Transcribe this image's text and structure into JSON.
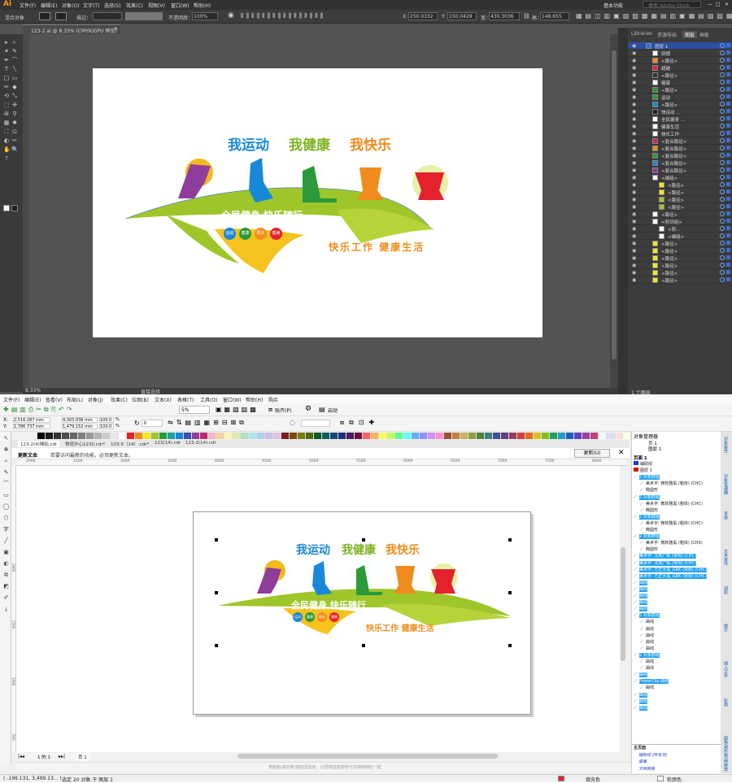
{
  "illustrator": {
    "logo": "Ai",
    "menu": [
      "文件(F)",
      "编辑(E)",
      "对象(O)",
      "文字(T)",
      "选择(S)",
      "效果(C)",
      "视图(V)",
      "窗口(W)",
      "帮助(H)"
    ],
    "workspace": "基本功能",
    "search_placeholder": "搜索 Adobe Stock",
    "control": {
      "selection": "混合对象",
      "stroke_label": "描边：",
      "opacity_label": "不透明度：",
      "opacity": "100%",
      "x_label": "X:",
      "x": "250.0332",
      "y_label": "Y:",
      "y": "150.0429",
      "w_label": "宽：",
      "w": "430.3036",
      "h_label": "高：",
      "h": "148.655"
    },
    "doc_tab": "123-2.ai @ 8.33% (CMYK/GPU 预览)",
    "zoom": "8.33%",
    "status_mode": "直接选择",
    "artwork": {
      "title": [
        "我运动",
        "我健康",
        "我快乐"
      ],
      "slogan1": "全民健身 快乐随行",
      "badges": [
        "运动",
        "健康",
        "阳光",
        "健美"
      ],
      "slogan2": "快乐工作 健康生活"
    },
    "panel_tabs": [
      "Libraries",
      "资源导出",
      "图层",
      "画板"
    ],
    "layers_footer": "1 个图层",
    "layers": [
      {
        "name": "图层 1",
        "color": "#3b6dd6",
        "indent": 0
      },
      {
        "name": "拼搏",
        "color": "#ffffff",
        "indent": 1
      },
      {
        "name": "<路径>",
        "color": "#f08c1e",
        "indent": 1
      },
      {
        "name": "超越",
        "color": "#e4222e",
        "indent": 1
      },
      {
        "name": "<路径>",
        "color": "#333333",
        "indent": 1
      },
      {
        "name": "健康",
        "color": "#ffffff",
        "indent": 1
      },
      {
        "name": "<路径>",
        "color": "#2a9a3a",
        "indent": 1
      },
      {
        "name": "运动",
        "color": "#2a9a3a",
        "indent": 1
      },
      {
        "name": "<路径>",
        "color": "#1a88d8",
        "indent": 1
      },
      {
        "name": "快运动 ...",
        "color": "#222222",
        "indent": 1
      },
      {
        "name": "全民健身 ...",
        "color": "#ffffff",
        "indent": 1
      },
      {
        "name": "健康生活",
        "color": "#ffffff",
        "indent": 1
      },
      {
        "name": "快乐工作",
        "color": "#ffffff",
        "indent": 1
      },
      {
        "name": "<复合路径>",
        "color": "#c0266a",
        "indent": 1
      },
      {
        "name": "<复合路径>",
        "color": "#f08c1e",
        "indent": 1
      },
      {
        "name": "<复合路径>",
        "color": "#2a9a3a",
        "indent": 1
      },
      {
        "name": "<复合路径>",
        "color": "#1a88d8",
        "indent": 1
      },
      {
        "name": "<复合路径>",
        "color": "#8e3d9a",
        "indent": 1
      },
      {
        "name": "<编组>",
        "color": "#ffffff",
        "indent": 1
      },
      {
        "name": "<路径>",
        "color": "#f5e71f",
        "indent": 2
      },
      {
        "name": "<路径>",
        "color": "#f5e71f",
        "indent": 2
      },
      {
        "name": "<路径>",
        "color": "#9ec62a",
        "indent": 2
      },
      {
        "name": "<路径>",
        "color": "#9ec62a",
        "indent": 2
      },
      {
        "name": "<路径>",
        "color": "#ffffff",
        "indent": 1
      },
      {
        "name": "<剪切组>",
        "color": "#ffffff",
        "indent": 1
      },
      {
        "name": "<剪...",
        "color": "#ffffff",
        "indent": 2
      },
      {
        "name": "<编组>",
        "color": "#ffffff",
        "indent": 2
      },
      {
        "name": "<路径>",
        "color": "#f5e71f",
        "indent": 1
      },
      {
        "name": "<路径>",
        "color": "#f5e71f",
        "indent": 1
      },
      {
        "name": "<路径>",
        "color": "#f5e71f",
        "indent": 1
      },
      {
        "name": "<路径>",
        "color": "#f5e71f",
        "indent": 1
      },
      {
        "name": "<路径>",
        "color": "#f5e71f",
        "indent": 1
      },
      {
        "name": "<路径>",
        "color": "#f5e71f",
        "indent": 1
      }
    ]
  },
  "corel": {
    "menu": [
      "文件(F)",
      "编辑(E)",
      "查看(V)",
      "布局(L)",
      "对象(J)",
      "效果(C)",
      "位图(B)",
      "文本(X)",
      "表格(T)",
      "工具(O)",
      "窗口(W)",
      "帮助(H)",
      "购买"
    ],
    "toolbar": {
      "zoom": "5%",
      "snap": "贴齐(P)",
      "launch": "启动"
    },
    "prop": {
      "x": "2,516.287 mm",
      "y": "1,786.737 mm",
      "w": "4,303.036 mm",
      "h": "1,479.152 mm",
      "sx": "100.0",
      "sy": "100.0",
      "pct": "%",
      "angle": ".0"
    },
    "doc_tabs": [
      "123-2(4)稀贴.cdr",
      "物流中心1230.cdr*",
      "103-5（14）.cdr*",
      "123(14).cdr",
      "123-2(14).cdr"
    ],
    "hint_label": "更新文本",
    "hint_text": "若要访问最新的功能，必须更新文本。",
    "update_btn": "更新(U)",
    "ruler": [
      "2000",
      "2500",
      "3000",
      "3500",
      "4000",
      "4500",
      "5000",
      "5500",
      "6000",
      "6500",
      "7000",
      "7500",
      "8000"
    ],
    "vruler": [
      "2000",
      "1500",
      "1000",
      "500"
    ],
    "artwork": {
      "title": [
        "我运动",
        "我健康",
        "我快乐"
      ],
      "slogan1": "全民健身 快乐随行",
      "badges": [
        "运动",
        "健康",
        "阳光",
        "健美"
      ],
      "slogan2": "快乐工作 健康生活"
    },
    "objmgr_title": "对象管理器",
    "objmgr_page": "页 1",
    "objmgr_layer": "图层 1",
    "objmgr_page1": "页面 1",
    "objects": [
      {
        "t": "辅助线",
        "sel": false,
        "ind": 1,
        "color": "#1a3ad0"
      },
      {
        "t": "图层 1",
        "sel": false,
        "ind": 1,
        "color": "#d01a1a"
      },
      {
        "t": "2 对象群组",
        "sel": true,
        "ind": 1
      },
      {
        "t": "美术字: 微软雅黑 (粗体) (CHC)",
        "sel": false,
        "ind": 2
      },
      {
        "t": "椭圆形",
        "sel": false,
        "ind": 2
      },
      {
        "t": "2 对象群组",
        "sel": true,
        "ind": 1
      },
      {
        "t": "美术字: 微软雅黑 (粗体) (CHC)",
        "sel": false,
        "ind": 2
      },
      {
        "t": "椭圆形",
        "sel": false,
        "ind": 2
      },
      {
        "t": "2 对象群组",
        "sel": true,
        "ind": 1
      },
      {
        "t": "美术字: 微软雅黑 (粗体) (CHC)",
        "sel": false,
        "ind": 2
      },
      {
        "t": "椭圆形",
        "sel": false,
        "ind": 2
      },
      {
        "t": "2 对象群组",
        "sel": true,
        "ind": 1
      },
      {
        "t": "美术字: 微软雅黑 (粗体) (CHS)",
        "sel": false,
        "ind": 2
      },
      {
        "t": "椭圆形",
        "sel": false,
        "ind": 2
      },
      {
        "t": "美术字: 汉真广标 (常规) (CHC)",
        "sel": true,
        "ind": 1
      },
      {
        "t": "美术字: 汉真广标 (常规) (CHC)",
        "sel": true,
        "ind": 1
      },
      {
        "t": "美术字: 方正大黑_GBK (常规) (CHC)",
        "sel": true,
        "ind": 1
      },
      {
        "t": "美术字: 方正大黑_GBK (常规) (CHC)",
        "sel": true,
        "ind": 1
      },
      {
        "t": "曲线",
        "sel": true,
        "ind": 1
      },
      {
        "t": "曲线",
        "sel": true,
        "ind": 1
      },
      {
        "t": "曲线",
        "sel": true,
        "ind": 1
      },
      {
        "t": "曲线",
        "sel": true,
        "ind": 1
      },
      {
        "t": "曲线",
        "sel": true,
        "ind": 1
      },
      {
        "t": "5 对象群组",
        "sel": true,
        "ind": 1
      },
      {
        "t": "曲线",
        "sel": false,
        "ind": 2
      },
      {
        "t": "曲线",
        "sel": false,
        "ind": 2
      },
      {
        "t": "曲线",
        "sel": false,
        "ind": 2
      },
      {
        "t": "曲线",
        "sel": false,
        "ind": 2
      },
      {
        "t": "曲线",
        "sel": false,
        "ind": 2
      },
      {
        "t": "2 对象群组",
        "sel": true,
        "ind": 1
      },
      {
        "t": "曲线",
        "sel": false,
        "ind": 2
      },
      {
        "t": "曲线",
        "sel": false,
        "ind": 2
      },
      {
        "t": "曲线",
        "sel": true,
        "ind": 1
      },
      {
        "t": "PowerClip 曲线",
        "sel": true,
        "ind": 1
      },
      {
        "t": "曲线",
        "sel": false,
        "ind": 2
      },
      {
        "t": "曲线",
        "sel": true,
        "ind": 1
      },
      {
        "t": "曲线",
        "sel": true,
        "ind": 1
      },
      {
        "t": "曲线",
        "sel": true,
        "ind": 1
      }
    ],
    "master": [
      {
        "t": "主页面"
      },
      {
        "t": "辅助线 (所有页)",
        "color": "#1a3ad0"
      },
      {
        "t": "桌面",
        "color": "#1a3ad0"
      },
      {
        "t": "文档网格",
        "color": "#1a3ad0"
      }
    ],
    "dock_tabs": [
      "对象属性",
      "对象管理器",
      "变换",
      "文本属性",
      "调和",
      "提示",
      "插入字符",
      "轮廓",
      "圆角/扇形角/倒棱角"
    ],
    "page_nav": "1 的 1",
    "page_tab": "页 1",
    "hint_bottom": "将颜色(或对象)拖动至此处，以便将这些颜色与文档存储在一起",
    "status_coords": "( -199.131, 3,499.13... )",
    "status_sel": "选定 20 对象 于 图层 1",
    "status_fill": "填充色",
    "status_outline": "轮廓色"
  },
  "palette": [
    "#000",
    "#1a1a1a",
    "#333",
    "#4d4d4d",
    "#666",
    "#808080",
    "#999",
    "#b3b3b3",
    "#ccc",
    "#e6e6e6",
    "#fff",
    "#e4222e",
    "#f08c1e",
    "#f5e71f",
    "#9ec62a",
    "#2a9a3a",
    "#1aa3a0",
    "#1a88d8",
    "#3b4fb0",
    "#8e3d9a",
    "#c0266a",
    "#f2b8c6",
    "#f7d1a6",
    "#fff3b0",
    "#d6ecb0",
    "#b0e0c0",
    "#b0e4ec",
    "#b0d0f0",
    "#c8c0e8",
    "#e0c0e0",
    "#7a2020",
    "#7a4a10",
    "#7a7a10",
    "#4a6a10",
    "#105a20",
    "#106060",
    "#104a7a",
    "#20307a",
    "#4a1a5a",
    "#6a1040",
    "#ff6060",
    "#ffb060",
    "#ffff60",
    "#c0ff60",
    "#60ff90",
    "#60ffff",
    "#60b0ff",
    "#9090ff",
    "#d090ff",
    "#ff90d0",
    "#a05030",
    "#c08040",
    "#d0b060",
    "#90a040",
    "#508040",
    "#408080",
    "#405090",
    "#604080",
    "#904060",
    "#d04040",
    "#e07020",
    "#e0c020",
    "#80c020",
    "#20a060",
    "#20a0c0",
    "#2060c0",
    "#6040c0",
    "#a040a0",
    "#c04080",
    "#efe",
    "#ddf",
    "#fdd",
    "#ffd",
    "#dfd",
    "#dff",
    "#fdf",
    "#ccc",
    "#999",
    "#666",
    "#333",
    "#000"
  ]
}
